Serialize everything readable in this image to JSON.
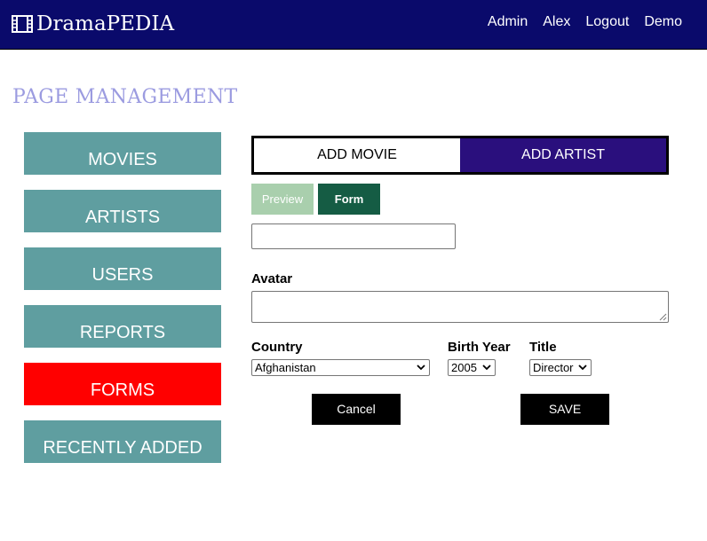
{
  "header": {
    "brand": "DramaPEDIA",
    "nav": [
      "Admin",
      "Alex",
      "Logout",
      "Demo"
    ]
  },
  "page_title": "PAGE MANAGEMENT",
  "sidebar": {
    "items": [
      {
        "label": "MOVIES"
      },
      {
        "label": "ARTISTS"
      },
      {
        "label": "USERS"
      },
      {
        "label": "REPORTS"
      },
      {
        "label": "FORMS",
        "active": true
      },
      {
        "label": "RECENTLY ADDED"
      }
    ]
  },
  "tabs": {
    "add_movie": "ADD MOVIE",
    "add_artist": "ADD ARTIST",
    "active": "ADD ARTIST"
  },
  "subtabs": {
    "preview": "Preview",
    "form": "Form"
  },
  "form": {
    "name_value": "",
    "avatar_label": "Avatar",
    "avatar_value": "",
    "country_label": "Country",
    "country_value": "Afghanistan",
    "birth_year_label": "Birth Year",
    "birth_year_value": "2005",
    "title_label": "Title",
    "title_value": "Director",
    "cancel_label": "Cancel",
    "save_label": "SAVE"
  },
  "colors": {
    "header_bg": "#0a0a6b",
    "sidebar_item": "#5f9ea0",
    "sidebar_active": "#ff0000",
    "tab_active": "#2a0f7d",
    "preview_tab": "#a9cfad",
    "form_tab": "#155c44",
    "title": "#9b9be0"
  }
}
